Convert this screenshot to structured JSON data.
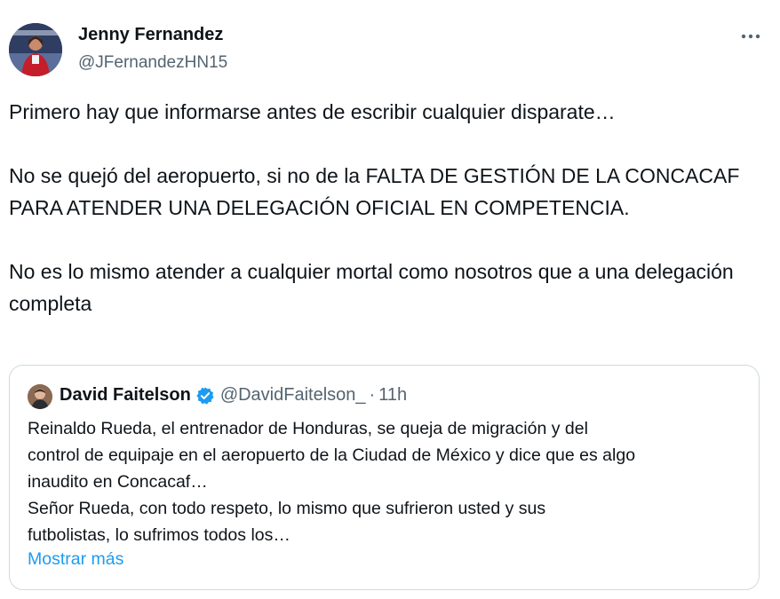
{
  "tweet": {
    "author": {
      "name": "Jenny Fernandez",
      "handle": "@JFernandezHN15"
    },
    "more_icon": "more-horizontal-icon",
    "paragraphs": [
      "Primero hay que informarse antes de escribir cualquier disparate…",
      "No se quejó del aeropuerto, si no de la FALTA DE GESTIÓN DE LA CONCACAF PARA ATENDER UNA DELEGACIÓN OFICIAL EN COMPETENCIA.",
      "No es lo mismo atender a cualquier mortal como nosotros que a una delegación completa"
    ],
    "quote": {
      "author": {
        "name": "David Faitelson",
        "handle": "@DavidFaitelson_",
        "verified_icon": "verified-badge-icon"
      },
      "separator": "·",
      "time": "11h",
      "lines": [
        "Reinaldo Rueda, el entrenador de Honduras, se queja de migración y del",
        "control de equipaje en el aeropuerto de la Ciudad de México y dice que es algo",
        "inaudito en Concacaf…",
        "Señor Rueda, con todo respeto, lo mismo que sufrieron usted y sus",
        "futbolistas, lo sufrimos todos los…"
      ],
      "show_more": "Mostrar más"
    }
  },
  "colors": {
    "text": "#0f1419",
    "secondary": "#536471",
    "link": "#1d9bf0",
    "border": "#cfd9de",
    "verified": "#1d9bf0"
  }
}
